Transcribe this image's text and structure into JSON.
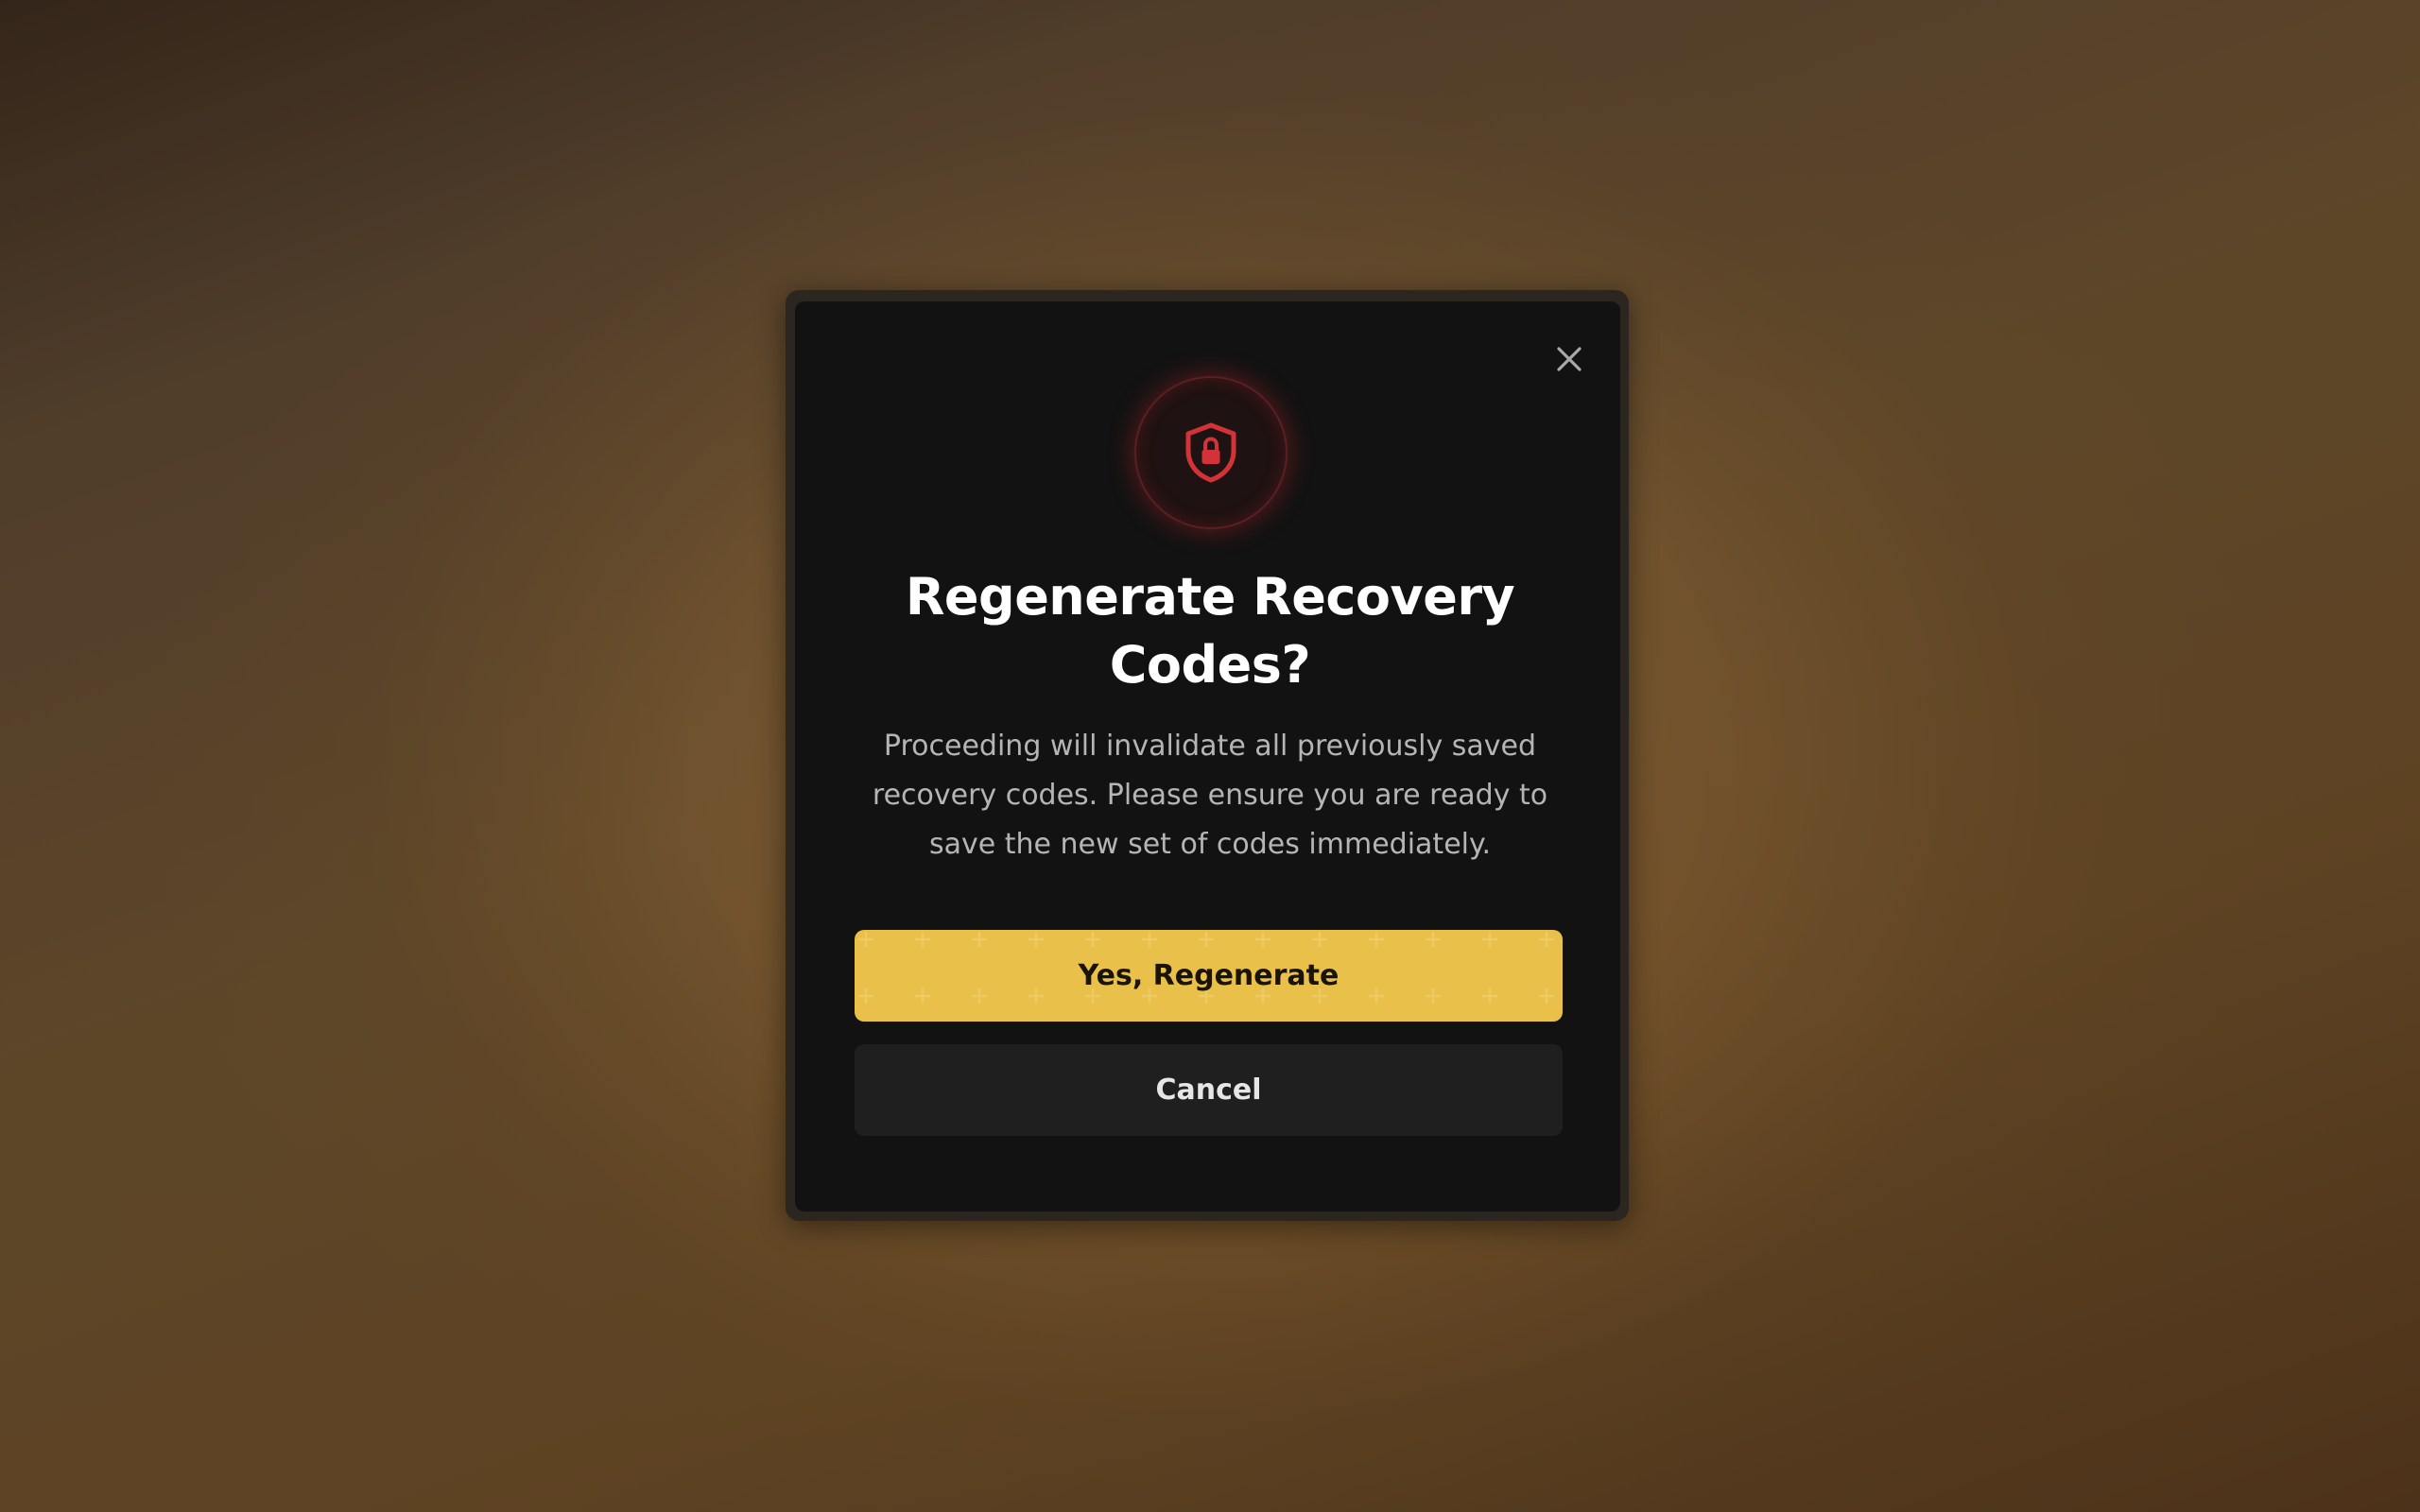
{
  "dialog": {
    "title": "Regenerate Recovery Codes?",
    "description": "Proceeding will invalidate all previously saved recovery codes. Please ensure you are ready to save the new set of codes immediately.",
    "icon": "shield-lock-icon",
    "close_icon": "close-icon",
    "confirm_label": "Yes, Regenerate",
    "cancel_label": "Cancel"
  },
  "colors": {
    "accent": "#d9a50f",
    "danger": "#c8282d",
    "dialog_bg": "#121212",
    "secondary_button_bg": "#1f1f1f"
  }
}
